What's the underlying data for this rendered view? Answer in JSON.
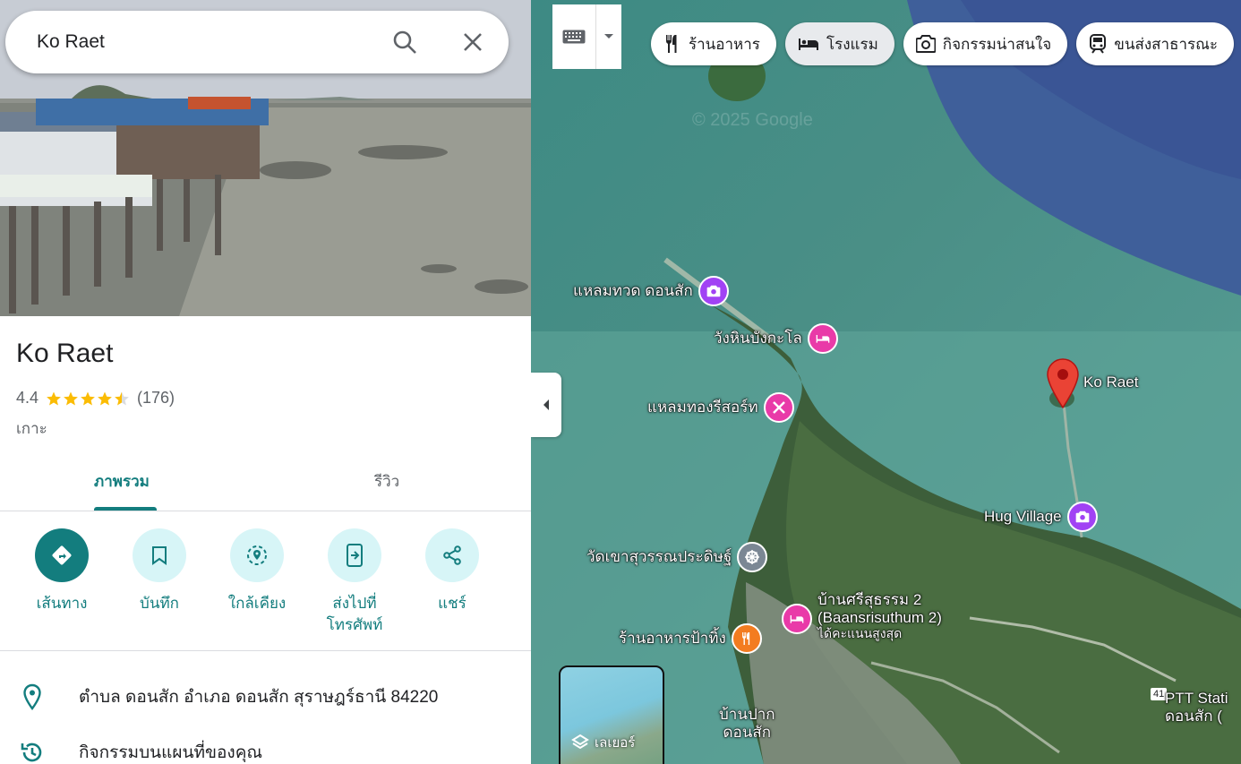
{
  "search": {
    "query": "Ko Raet"
  },
  "place": {
    "name": "Ko Raet",
    "rating": "4.4",
    "rating_value": 4.4,
    "review_count": "(176)",
    "type": "เกาะ"
  },
  "tabs": [
    {
      "label": "ภาพรวม"
    },
    {
      "label": "รีวิว"
    }
  ],
  "actions": [
    {
      "label": "เส้นทาง",
      "icon": "directions-icon"
    },
    {
      "label": "บันทึก",
      "icon": "bookmark-icon"
    },
    {
      "label": "ใกล้เคียง",
      "icon": "nearby-icon"
    },
    {
      "label": "ส่งไปที่\nโทรศัพท์",
      "label_line1": "ส่งไปที่",
      "label_line2": "โทรศัพท์",
      "icon": "send-to-phone-icon"
    },
    {
      "label": "แชร์",
      "icon": "share-icon"
    }
  ],
  "info": {
    "address": "ตำบล ดอนสัก อำเภอ ดอนสัก สุราษฎร์ธานี 84220",
    "activity": "กิจกรรมบนแผนที่ของคุณ"
  },
  "map": {
    "chips": [
      {
        "label": "ร้านอาหาร",
        "icon": "restaurant-icon"
      },
      {
        "label": "โรงแรม",
        "icon": "hotel-icon"
      },
      {
        "label": "กิจกรรมน่าสนใจ",
        "icon": "camera-icon"
      },
      {
        "label": "ขนส่งสาธารณะ",
        "icon": "transit-icon"
      }
    ],
    "watermark": "© 2025 Google",
    "pois": {
      "laemthuat": "แหลมทวด ดอนสัก",
      "wanghin": "วังหินบังกะโล",
      "laemthong": "แหลมทองรีสอร์ท",
      "koraet": "Ko Raet",
      "hug": "Hug Village",
      "watkhao": "วัดเขาสุวรรณประดิษฐ์",
      "baansri_th": "บ้านศรีสุธรรม 2",
      "baansri_en": "(Baansrisuthum 2)",
      "baansri_note": "ได้คะแนนสูงสุด",
      "ranahan": "ร้านอาหารป้าทิ้ง",
      "baanpak_1": "บ้านปาก",
      "baanpak_2": "ดอนสัก",
      "ptt_1": "PTT Stati",
      "ptt_2": "ดอนสัก (",
      "road_shield": "41"
    },
    "layers_label": "เลเยอร์"
  },
  "colors": {
    "accent": "#137d7e",
    "accent_light": "#d7f5f7",
    "star": "#fbbc04",
    "pin_red": "#ea4335"
  }
}
